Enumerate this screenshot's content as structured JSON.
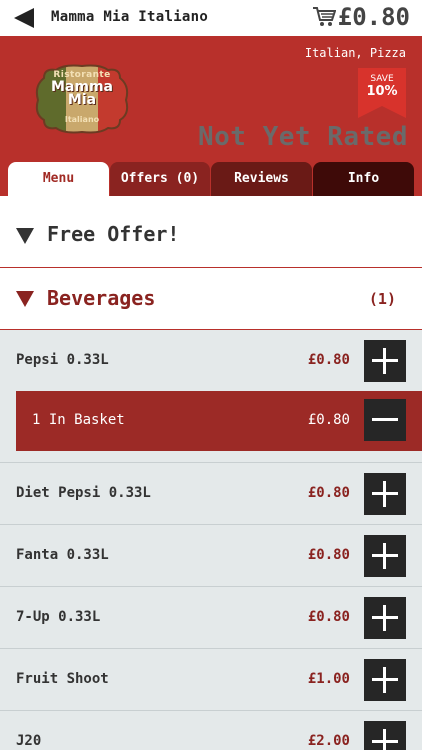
{
  "topbar": {
    "title": "Mamma Mia Italiano",
    "cart_total": "£0.80"
  },
  "restaurant": {
    "cuisine": "Italian, Pizza",
    "logo": {
      "top": "Ristorante",
      "main_line1": "Mamma",
      "main_line2": "Mia",
      "bottom": "Italiano"
    },
    "save_label": "SAVE",
    "save_percent": "10%",
    "rating": "Not Yet Rated"
  },
  "tabs": [
    {
      "label": "Menu",
      "active": true
    },
    {
      "label": "Offers (0)"
    },
    {
      "label": "Reviews"
    },
    {
      "label": "Info"
    }
  ],
  "sections": {
    "free_offer": {
      "title": "Free Offer!"
    },
    "beverages": {
      "title": "Beverages",
      "count": "(1)"
    }
  },
  "items": [
    {
      "name": "Pepsi 0.33L",
      "price": "£0.80"
    },
    {
      "name": "Diet Pepsi 0.33L",
      "price": "£0.80"
    },
    {
      "name": "Fanta 0.33L",
      "price": "£0.80"
    },
    {
      "name": "7-Up 0.33L",
      "price": "£0.80"
    },
    {
      "name": "Fruit Shoot",
      "price": "£1.00"
    },
    {
      "name": "J20",
      "price": "£2.00"
    }
  ],
  "basket": {
    "label": "1 In Basket",
    "price": "£0.80"
  },
  "colors": {
    "brand_red": "#b8302b",
    "dark_red": "#8a2320",
    "button_dark": "#262626",
    "row_bg": "#e4e9ea"
  }
}
